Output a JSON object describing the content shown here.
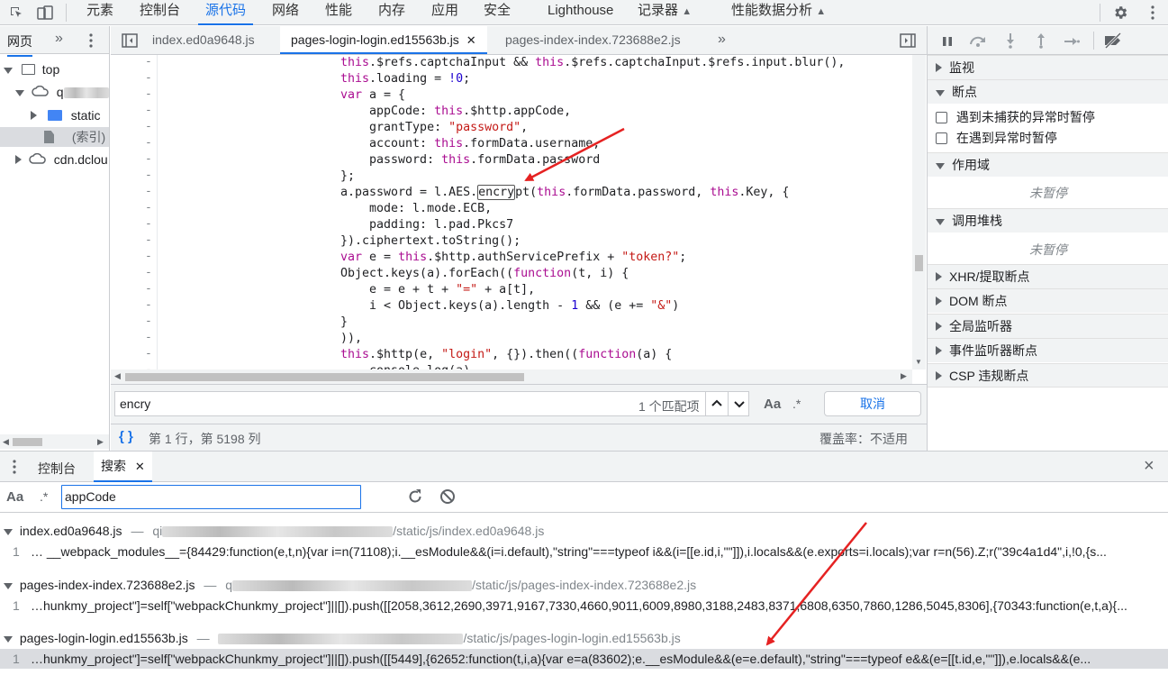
{
  "topbar": {
    "tabs": [
      "元素",
      "控制台",
      "源代码",
      "网络",
      "性能",
      "内存",
      "应用",
      "安全",
      "Lighthouse",
      "记录器",
      "性能数据分析"
    ],
    "active_tab": "源代码",
    "icons": [
      "inspect-icon",
      "device-icon",
      "gear-icon",
      "more-vert-icon"
    ]
  },
  "navigator": {
    "tabs": [
      "网页",
      "»"
    ],
    "tree": [
      {
        "label": "top",
        "level": 0
      },
      {
        "label": "q",
        "level": 1
      },
      {
        "label": "static",
        "level": 2
      },
      {
        "label": "(索引)",
        "level": 2
      },
      {
        "label": "cdn.dclou",
        "level": 1
      }
    ]
  },
  "editor": {
    "tabs": [
      "index.ed0a9648.js",
      "pages-login-login.ed15563b.js",
      "pages-index-index.723688e2.js"
    ],
    "active_tab": "pages-login-login.ed15563b.js",
    "overflow": "»",
    "gutter_marker": "-",
    "code_lines": [
      "this.$refs.captchaInput && this.$refs.captchaInput.$refs.input.blur(),",
      "this.loading = !0;",
      "var a = {",
      "    appCode: this.$http.appCode,",
      "    grantType: \"password\",",
      "    account: this.formData.username,",
      "    password: this.formData.password",
      "};",
      "a.password = l.AES.encrypt(this.formData.password, this.Key, {",
      "    mode: l.mode.ECB,",
      "    padding: l.pad.Pkcs7",
      "}).ciphertext.toString();",
      "var e = this.$http.authServicePrefix + \"token?\";",
      "Object.keys(a).forEach((function(t, i) {",
      "    e = e + t + \"=\" + a[t],",
      "    i < Object.keys(a).length - 1 && (e += \"&\")",
      "}",
      ")),",
      "this.$http(e, \"login\", {}).then((function(a) {",
      "    console.log(a)"
    ]
  },
  "findbar": {
    "query": "encry",
    "match_count": "1 个匹配项",
    "aa": "Aa",
    "regex": ".*",
    "cancel": "取消"
  },
  "statusbar": {
    "braces": "{ }",
    "position": "第 1 行，第 5198 列",
    "coverage": "覆盖率：不适用"
  },
  "debugger": {
    "sections": {
      "watch": "监视",
      "breakpoints": "断点",
      "pause_uncaught": "遇到未捕获的异常时暂停",
      "pause_caught": "在遇到异常时暂停",
      "scope": "作用域",
      "not_paused_1": "未暂停",
      "call_stack": "调用堆栈",
      "not_paused_2": "未暂停",
      "xhr": "XHR/提取断点",
      "dom": "DOM 断点",
      "global": "全局监听器",
      "event": "事件监听器断点",
      "csp": "CSP 违规断点"
    }
  },
  "drawer": {
    "tabs": [
      "控制台",
      "搜索"
    ],
    "active_tab": "搜索",
    "close_glyph": "×",
    "search": {
      "aa": "Aa",
      "regex": ".*",
      "query": "appCode"
    },
    "results": [
      {
        "file": "index.ed0a9648.js",
        "sep": "—",
        "host_prefix": "qi",
        "path": "/static/js/index.ed0a9648.js",
        "line_no": "1",
        "snippet": "…  __webpack_modules__={84429:function(e,t,n){var i=n(71108);i.__esModule&&(i=i.default),\"string\"===typeof i&&(i=[[e.id,i,\"\"]]),i.locals&&(e.exports=i.locals);var r=n(56).Z;r(\"39c4a1d4\",i,!0,{s..."
      },
      {
        "file": "pages-index-index.723688e2.js",
        "sep": "—",
        "host_prefix": "q",
        "path": "/static/js/pages-index-index.723688e2.js",
        "line_no": "1",
        "snippet": "…hunkmy_project\"]=self[\"webpackChunkmy_project\"]||[]).push([[2058,3612,2690,3971,9167,7330,4660,9011,6009,8980,3188,2483,8371,6808,6350,7860,1286,5045,8306],{70343:function(e,t,a){..."
      },
      {
        "file": "pages-login-login.ed15563b.js",
        "sep": "—",
        "host_prefix": "",
        "path": "/static/js/pages-login-login.ed15563b.js",
        "line_no": "1",
        "snippet": "…hunkmy_project\"]=self[\"webpackChunkmy_project\"]||[]).push([[5449],{62652:function(t,i,a){var e=a(83602);e.__esModule&&(e=e.default),\"string\"===typeof e&&(e=[[t.id,e,\"\"]]),e.locals&&(e..."
      }
    ]
  },
  "colors": {
    "accent": "#1a73e8",
    "arrow": "#e52222",
    "keyword": "#aa0d91",
    "string": "#c41a16",
    "number": "#1c00cf"
  }
}
